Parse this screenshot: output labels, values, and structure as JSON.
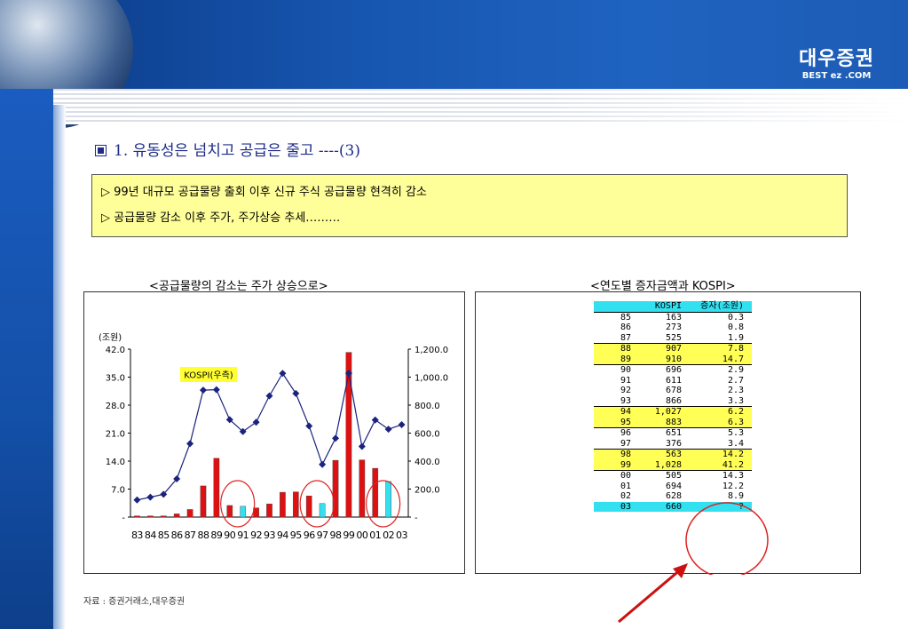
{
  "header": {
    "brand": "대우증권",
    "brand_sub": "BEST ez .COM"
  },
  "slide": {
    "title": "1. 유동성은 넘치고 공급은 줄고 ----(3)",
    "notes": [
      "▷ 99년 대규모 공급물량 출회 이후 신규 주식 공급물량 현격히 감소",
      "▷ 공급물량 감소 이후 주가, 주가상승 추세………"
    ]
  },
  "left_chart_title": "<공급물량의 감소는 주가 상승으로>",
  "right_chart_title": "<연도별 증자금액과 KOSPI>",
  "chart_data": {
    "type": "bar",
    "unit_label": "(조원)",
    "categories": [
      "83",
      "84",
      "85",
      "86",
      "87",
      "88",
      "89",
      "90",
      "91",
      "92",
      "93",
      "94",
      "95",
      "96",
      "97",
      "98",
      "99",
      "00",
      "01",
      "02",
      "03"
    ],
    "series": [
      {
        "values": [
          0.3,
          0.3,
          0.3,
          0.8,
          1.9,
          7.8,
          14.7,
          2.9,
          2.7,
          2.3,
          3.3,
          6.2,
          6.3,
          5.3,
          3.4,
          14.2,
          41.2,
          14.3,
          12.2,
          8.9,
          0
        ],
        "axis": "left"
      },
      {
        "name": "KOSPI(우측)",
        "values": [
          122,
          142,
          163,
          273,
          525,
          907,
          910,
          696,
          611,
          678,
          866,
          1027,
          883,
          651,
          376,
          563,
          1028,
          505,
          694,
          628,
          660
        ],
        "axis": "right",
        "type": "line"
      }
    ],
    "highlight_bars": [
      "91",
      "97",
      "02"
    ],
    "y_left": {
      "ticks": [
        "-",
        "7.0",
        "14.0",
        "21.0",
        "28.0",
        "35.0",
        "42.0"
      ],
      "range": [
        0,
        42
      ]
    },
    "y_right": {
      "ticks": [
        "-",
        "200.0",
        "400.0",
        "600.0",
        "800.0",
        "1,000.0",
        "1,200.0"
      ],
      "range": [
        0,
        1200
      ]
    },
    "colors": {
      "bar": "#dd1111",
      "bar_highlight": "#33e0f0",
      "line": "#1a237e",
      "legend_bg": "#ffff33",
      "circle": "#dd2222"
    }
  },
  "table": {
    "headers": [
      "",
      "KOSPI",
      "증자(조원)"
    ],
    "rows": [
      [
        "85",
        "163",
        "0.3"
      ],
      [
        "86",
        "273",
        "0.8"
      ],
      [
        "87",
        "525",
        "1.9"
      ],
      [
        "88",
        "907",
        "7.8"
      ],
      [
        "89",
        "910",
        "14.7"
      ],
      [
        "90",
        "696",
        "2.9"
      ],
      [
        "91",
        "611",
        "2.7"
      ],
      [
        "92",
        "678",
        "2.3"
      ],
      [
        "93",
        "866",
        "3.3"
      ],
      [
        "94",
        "1,027",
        "6.2"
      ],
      [
        "95",
        "883",
        "6.3"
      ],
      [
        "96",
        "651",
        "5.3"
      ],
      [
        "97",
        "376",
        "3.4"
      ],
      [
        "98",
        "563",
        "14.2"
      ],
      [
        "99",
        "1,028",
        "41.2"
      ],
      [
        "00",
        "505",
        "14.3"
      ],
      [
        "01",
        "694",
        "12.2"
      ],
      [
        "02",
        "628",
        "8.9"
      ],
      [
        "03",
        "660",
        "?"
      ]
    ],
    "highlight_rows": {
      "yellow": [
        "88",
        "89",
        "94",
        "95",
        "98",
        "99"
      ],
      "cyan": [
        "03"
      ]
    },
    "group_starts": [
      "88",
      "90",
      "94",
      "96",
      "98",
      "00"
    ]
  },
  "source": "자료 : 증권거래소,대우증권"
}
